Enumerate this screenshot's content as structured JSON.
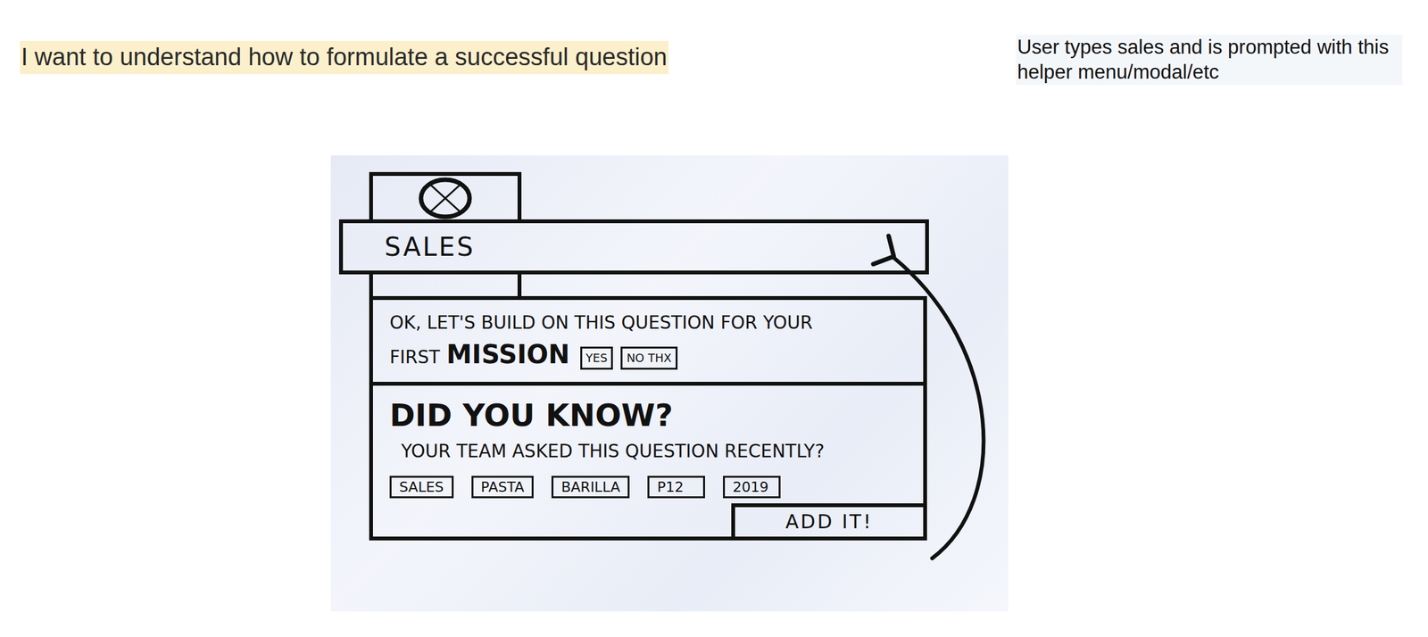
{
  "note": {
    "text": "I want to understand how to formulate a successful question",
    "highlighted": true
  },
  "comment": {
    "text": "User types sales and is prompted with this helper menu/modal/etc"
  },
  "sketch": {
    "search": {
      "value": "SALES"
    },
    "prompt": {
      "text": "OK, LET'S BUILD ON THIS QUESTION FOR YOUR FIRST",
      "emphasis": "MISSION",
      "buttons": [
        "YES",
        "NO THX"
      ]
    },
    "tip": {
      "title": "DID YOU KNOW?",
      "text": "YOUR TEAM ASKED THIS QUESTION RECENTLY?",
      "chips": [
        "SALES",
        "PASTA",
        "BARILLA",
        "P12",
        "2019"
      ],
      "action": "ADD IT!"
    }
  }
}
